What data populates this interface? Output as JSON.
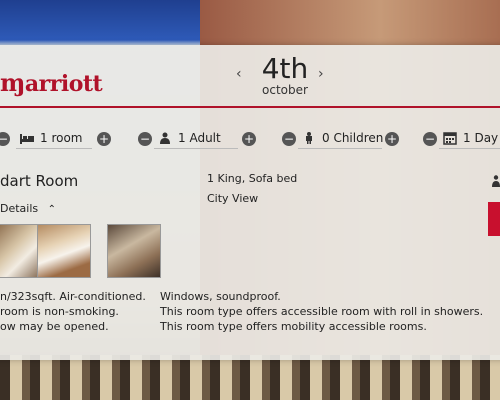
{
  "brand": {
    "logo_text": "arriott",
    "color": "#b0122a"
  },
  "date": {
    "day": "4th",
    "month": "october"
  },
  "steppers": {
    "rooms": {
      "value": "1 room",
      "icon": "bed-icon"
    },
    "adults": {
      "value": "1 Adult",
      "icon": "person-icon"
    },
    "children": {
      "value": "0 Children",
      "icon": "child-icon"
    },
    "days": {
      "value": "1 Day",
      "icon": "calendar-icon"
    }
  },
  "room": {
    "title": "dart Room",
    "details_label": "Details",
    "bed": "1 King, Sofa bed",
    "view": "City View",
    "left_lines": [
      "n/323sqft. Air-conditioned.",
      "room is non-smoking.",
      "ow may be opened."
    ],
    "right_lines": [
      "Windows, soundproof.",
      "This room type offers accessible room with roll in showers.",
      "This room type offers mobility accessible rooms."
    ]
  },
  "accent": "#c8102e"
}
